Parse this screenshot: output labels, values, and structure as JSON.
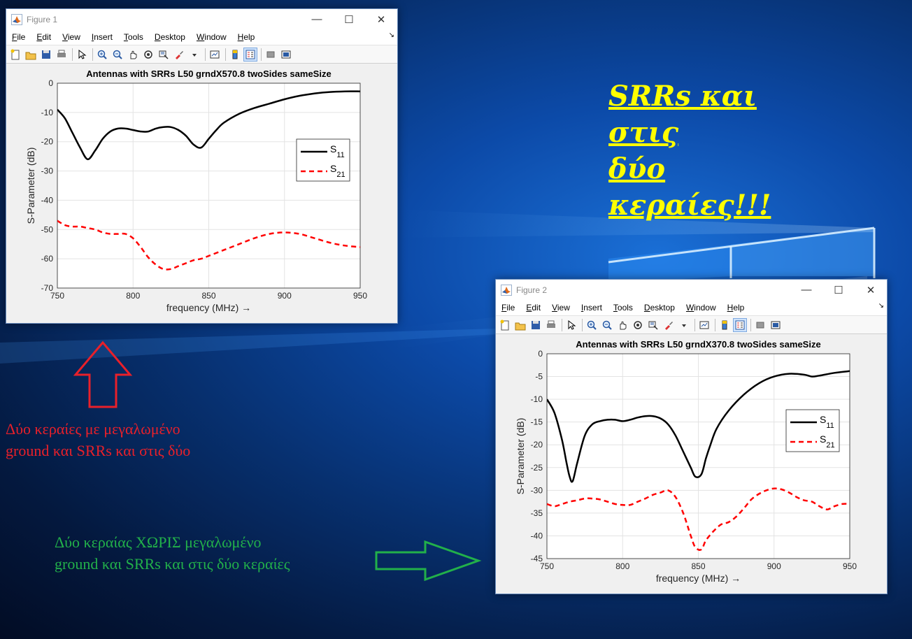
{
  "annotations": {
    "headline_line1": "SRRs και στις",
    "headline_line2": "δύο κεραίες!!!",
    "red_note_line1": "Δύο κεραίες με μεγαλωμένο",
    "red_note_line2": "ground και SRRs και στις δύο",
    "green_note_line1": "Δύο κεραίας ΧΩΡΙΣ μεγαλωμένο",
    "green_note_line2": "ground και SRRs και στις δύο κεραίες",
    "colors": {
      "headline": "#ffff00",
      "red": "#e8202a",
      "green": "#22b04a"
    }
  },
  "menu": [
    "File",
    "Edit",
    "View",
    "Insert",
    "Tools",
    "Desktop",
    "Window",
    "Help"
  ],
  "window_controls": {
    "minimize": "—",
    "maximize": "☐",
    "close": "✕"
  },
  "toolbar_icons": [
    "new-figure-icon",
    "open-file-icon",
    "save-icon",
    "print-icon",
    "pointer-icon",
    "zoom-in-icon",
    "zoom-out-icon",
    "pan-icon",
    "rotate-icon",
    "data-cursor-icon",
    "brush-icon",
    "dropdown-arrow-icon",
    "link-plot-icon",
    "colorbar-icon",
    "legend-icon",
    "hide-tools-icon",
    "show-tools-icon"
  ],
  "figures": [
    {
      "window_title": "Figure 1"
    },
    {
      "window_title": "Figure 2"
    }
  ],
  "chart_data": [
    {
      "type": "line",
      "title": "Antennas with SRRs L50 grndX570.8 twoSides sameSize",
      "xlabel": "frequency (MHz) →",
      "ylabel": "S-Parameter (dB)",
      "xlim": [
        750,
        950
      ],
      "ylim": [
        -70,
        0
      ],
      "xticks": [
        750,
        800,
        850,
        900,
        950
      ],
      "yticks": [
        0,
        -10,
        -20,
        -30,
        -40,
        -50,
        -60,
        -70
      ],
      "grid": true,
      "legend": "right",
      "series": [
        {
          "name": "S",
          "subscript": "11",
          "style": "solid",
          "color": "#000000",
          "x": [
            750,
            755,
            760,
            765,
            770,
            775,
            780,
            785,
            790,
            795,
            800,
            805,
            810,
            815,
            820,
            825,
            830,
            835,
            840,
            845,
            850,
            855,
            860,
            870,
            880,
            890,
            900,
            910,
            920,
            930,
            940,
            950
          ],
          "y": [
            -9,
            -12,
            -17,
            -22,
            -26,
            -23,
            -19,
            -16.5,
            -15.5,
            -15.5,
            -16,
            -16.5,
            -16.5,
            -15.5,
            -15,
            -15,
            -16,
            -18,
            -21,
            -22,
            -19,
            -16,
            -13.5,
            -10.5,
            -8.5,
            -7,
            -5.5,
            -4.3,
            -3.5,
            -3,
            -2.8,
            -2.8
          ]
        },
        {
          "name": "S",
          "subscript": "21",
          "style": "dashed",
          "color": "#ff0000",
          "x": [
            750,
            755,
            760,
            765,
            770,
            775,
            780,
            785,
            790,
            795,
            800,
            805,
            810,
            815,
            820,
            825,
            830,
            835,
            840,
            845,
            850,
            860,
            870,
            880,
            890,
            900,
            910,
            920,
            930,
            940,
            950
          ],
          "y": [
            -47,
            -48.5,
            -49,
            -49,
            -49.5,
            -50,
            -51,
            -51.5,
            -51.5,
            -51.5,
            -53,
            -56,
            -59.5,
            -62,
            -63.5,
            -63.5,
            -62.5,
            -61.5,
            -60.5,
            -60,
            -59,
            -57,
            -55,
            -53,
            -51.5,
            -51,
            -51.5,
            -53,
            -54.5,
            -55.5,
            -56
          ]
        }
      ]
    },
    {
      "type": "line",
      "title": "Antennas with SRRs L50 grndX370.8 twoSides sameSize",
      "xlabel": "frequency (MHz) →",
      "ylabel": "S-Parameter (dB)",
      "xlim": [
        750,
        950
      ],
      "ylim": [
        -45,
        0
      ],
      "xticks": [
        750,
        800,
        850,
        900,
        950
      ],
      "yticks": [
        0,
        -5,
        -10,
        -15,
        -20,
        -25,
        -30,
        -35,
        -40,
        -45
      ],
      "grid": true,
      "legend": "right",
      "series": [
        {
          "name": "S",
          "subscript": "11",
          "style": "solid",
          "color": "#000000",
          "x": [
            750,
            755,
            760,
            763,
            765,
            767,
            770,
            775,
            780,
            785,
            790,
            795,
            800,
            805,
            810,
            815,
            820,
            825,
            830,
            835,
            840,
            845,
            848,
            852,
            855,
            858,
            862,
            870,
            880,
            890,
            900,
            910,
            920,
            925,
            930,
            940,
            950
          ],
          "y": [
            -10,
            -13,
            -19,
            -24,
            -27,
            -28,
            -24,
            -18,
            -15.5,
            -14.8,
            -14.5,
            -14.5,
            -14.8,
            -14.5,
            -14,
            -13.7,
            -13.7,
            -14.2,
            -15.5,
            -18,
            -21.5,
            -25,
            -27,
            -26.5,
            -23,
            -20,
            -16.5,
            -12.5,
            -9,
            -6.5,
            -5,
            -4.4,
            -4.6,
            -5,
            -4.8,
            -4.2,
            -3.8
          ]
        },
        {
          "name": "S",
          "subscript": "21",
          "style": "dashed",
          "color": "#ff0000",
          "x": [
            750,
            755,
            760,
            765,
            770,
            775,
            780,
            785,
            790,
            795,
            800,
            805,
            810,
            815,
            820,
            825,
            830,
            835,
            840,
            845,
            848,
            852,
            855,
            860,
            865,
            870,
            875,
            880,
            885,
            890,
            895,
            900,
            905,
            910,
            915,
            920,
            925,
            930,
            935,
            940,
            945,
            950
          ],
          "y": [
            -33,
            -33.5,
            -33,
            -32.5,
            -32.2,
            -31.8,
            -31.8,
            -32,
            -32.5,
            -33,
            -33.2,
            -33.2,
            -32.5,
            -31.8,
            -31,
            -30.5,
            -30,
            -31.5,
            -35,
            -40,
            -42.5,
            -43,
            -41,
            -39,
            -37.5,
            -37,
            -35.8,
            -34,
            -32,
            -30.8,
            -30,
            -29.6,
            -29.8,
            -30.5,
            -31.5,
            -32.2,
            -32.5,
            -33.5,
            -34.2,
            -33.5,
            -33,
            -33
          ]
        }
      ]
    }
  ]
}
